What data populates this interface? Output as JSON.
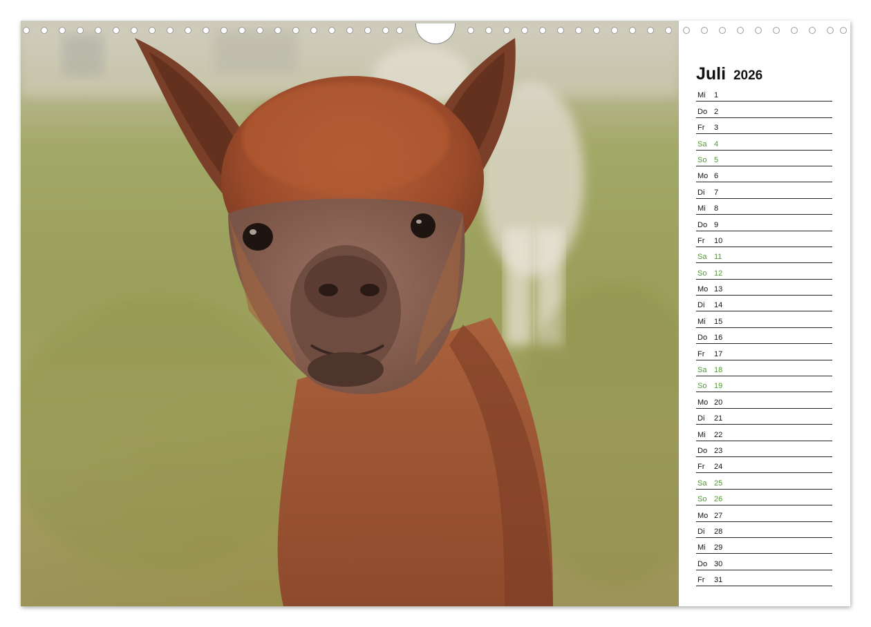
{
  "calendar": {
    "month": "Juli",
    "year": "2026",
    "weekend_color": "#4d9a2e",
    "days": [
      {
        "dow": "Mi",
        "num": "1"
      },
      {
        "dow": "Do",
        "num": "2"
      },
      {
        "dow": "Fr",
        "num": "3"
      },
      {
        "dow": "Sa",
        "num": "4"
      },
      {
        "dow": "So",
        "num": "5"
      },
      {
        "dow": "Mo",
        "num": "6"
      },
      {
        "dow": "Di",
        "num": "7"
      },
      {
        "dow": "Mi",
        "num": "8"
      },
      {
        "dow": "Do",
        "num": "9"
      },
      {
        "dow": "Fr",
        "num": "10"
      },
      {
        "dow": "Sa",
        "num": "11"
      },
      {
        "dow": "So",
        "num": "12"
      },
      {
        "dow": "Mo",
        "num": "13"
      },
      {
        "dow": "Di",
        "num": "14"
      },
      {
        "dow": "Mi",
        "num": "15"
      },
      {
        "dow": "Do",
        "num": "16"
      },
      {
        "dow": "Fr",
        "num": "17"
      },
      {
        "dow": "Sa",
        "num": "18"
      },
      {
        "dow": "So",
        "num": "19"
      },
      {
        "dow": "Mo",
        "num": "20"
      },
      {
        "dow": "Di",
        "num": "21"
      },
      {
        "dow": "Mi",
        "num": "22"
      },
      {
        "dow": "Do",
        "num": "23"
      },
      {
        "dow": "Fr",
        "num": "24"
      },
      {
        "dow": "Sa",
        "num": "25"
      },
      {
        "dow": "So",
        "num": "26"
      },
      {
        "dow": "Mo",
        "num": "27"
      },
      {
        "dow": "Di",
        "num": "28"
      },
      {
        "dow": "Mi",
        "num": "29"
      },
      {
        "dow": "Do",
        "num": "30"
      },
      {
        "dow": "Fr",
        "num": "31"
      }
    ]
  },
  "photo": {
    "subject": "alpaca-photo"
  }
}
